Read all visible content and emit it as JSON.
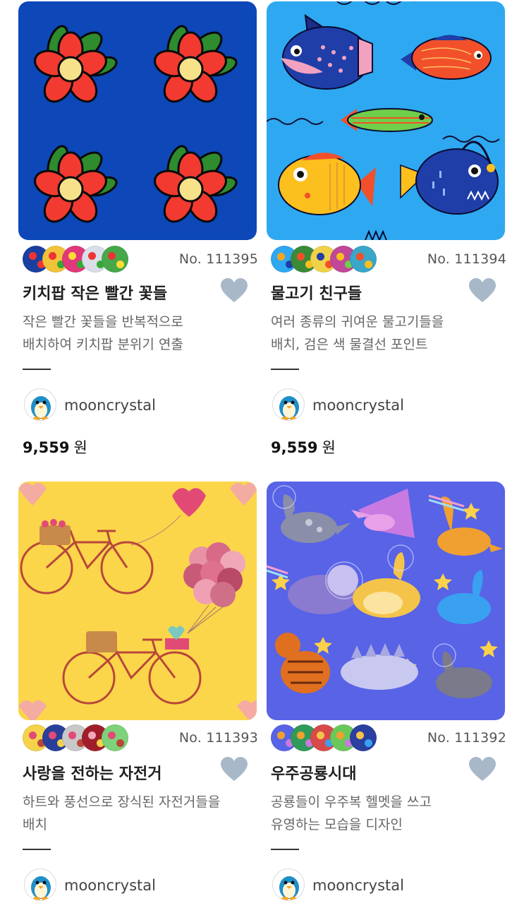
{
  "products": [
    {
      "number": "No. 111395",
      "title": "키치팝 작은 빨간 꽃들",
      "desc_line1": "작은 빨간 꽃들을 반복적으로",
      "desc_line2": "배치하여 키치팝 분위기 연출",
      "author": "mooncrystal",
      "price": "9,559",
      "currency": "원",
      "image": "red-flowers-pattern",
      "background": "#0d47b8",
      "swatch_colors": [
        "#1b3fa0",
        "#f2c33a",
        "#e0387a",
        "#d9dee8",
        "#47a84a"
      ],
      "liked": false
    },
    {
      "number": "No. 111394",
      "title": "물고기 친구들",
      "desc_line1": "여러 종류의 귀여운 물고기들을",
      "desc_line2": "배치, 검은 색 물결선 포인트",
      "author": "mooncrystal",
      "price": "9,559",
      "currency": "원",
      "image": "fish-pattern",
      "background": "#2ea8f0",
      "swatch_colors": [
        "#2ea8f0",
        "#3a8a3a",
        "#f0d24a",
        "#c0479a",
        "#3aa6c8"
      ],
      "liked": false
    },
    {
      "number": "No. 111393",
      "title": "사랑을 전하는 자전거",
      "desc_line1": "하트와 풍선으로 장식된 자전거들을",
      "desc_line2": "배치",
      "author": "mooncrystal",
      "image": "bicycle-balloons-pattern",
      "background": "#fbd64a",
      "swatch_colors": [
        "#f5d24a",
        "#2a3f9a",
        "#c8c8c8",
        "#a01e2a",
        "#7ed27a"
      ],
      "liked": false
    },
    {
      "number": "No. 111392",
      "title": "우주공룡시대",
      "desc_line1": "공룡들이 우주복 헬멧을 쓰고",
      "desc_line2": "유영하는 모습을 디자인",
      "author": "mooncrystal",
      "image": "space-dinosaurs-pattern",
      "background": "#5863e6",
      "swatch_colors": [
        "#5863e6",
        "#2f9a5a",
        "#d84a4a",
        "#6ac85a",
        "#2a3fa0"
      ],
      "liked": false
    }
  ],
  "icons": {
    "heart": "heart-icon",
    "avatar": "penguin-avatar"
  },
  "colors": {
    "heart": "#a9b8c8",
    "rule": "#333333"
  }
}
